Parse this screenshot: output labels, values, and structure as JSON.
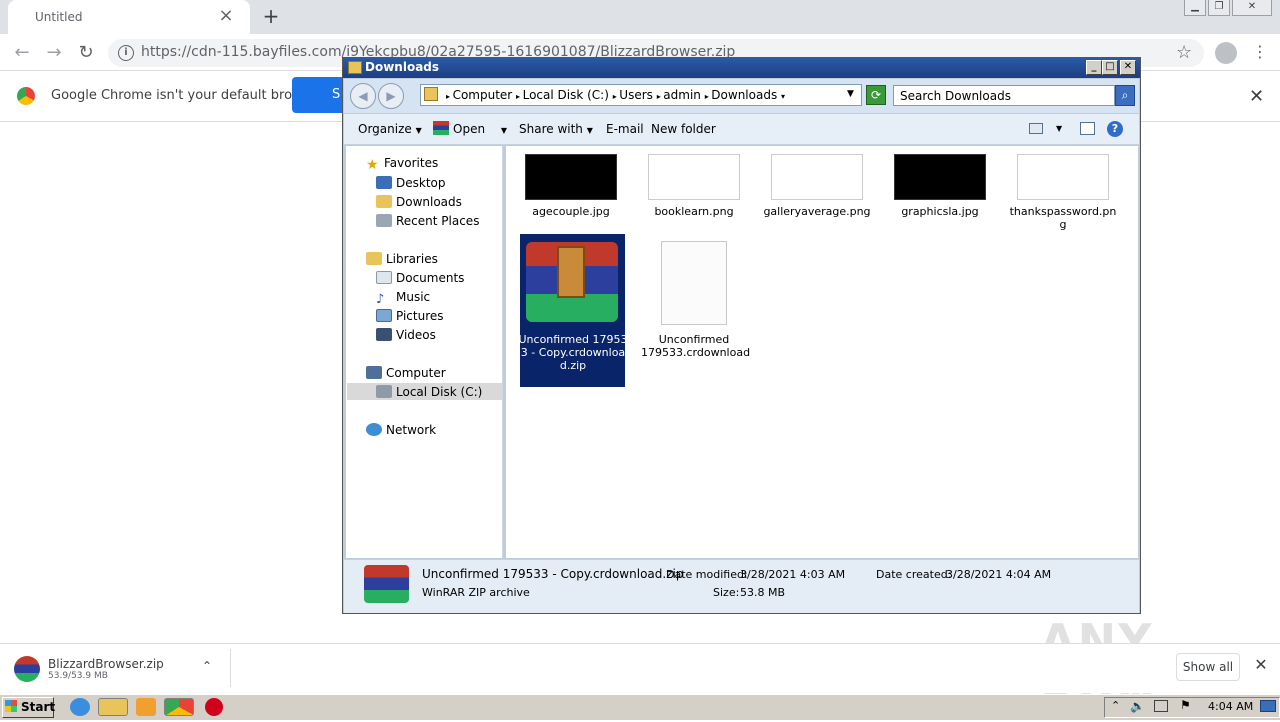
{
  "browser": {
    "tab_title": "Untitled",
    "url": "https://cdn-115.bayfiles.com/i9Yekcpbu8/02a27595-1616901087/BlizzardBrowser.zip",
    "infobar_text": "Google Chrome isn't your default browser",
    "infobar_button": "S"
  },
  "explorer": {
    "title": "Downloads",
    "breadcrumbs": [
      "Computer",
      "Local Disk (C:)",
      "Users",
      "admin",
      "Downloads"
    ],
    "search_placeholder": "Search Downloads",
    "commands": {
      "organize": "Organize",
      "open": "Open",
      "share_with": "Share with",
      "email": "E-mail",
      "new_folder": "New folder"
    },
    "nav": {
      "favorites": "Favorites",
      "desktop": "Desktop",
      "downloads": "Downloads",
      "recent_places": "Recent Places",
      "libraries": "Libraries",
      "documents": "Documents",
      "music": "Music",
      "pictures": "Pictures",
      "videos": "Videos",
      "computer": "Computer",
      "local_disk": "Local Disk (C:)",
      "network": "Network"
    },
    "files": [
      {
        "name": "agecouple.jpg"
      },
      {
        "name": "booklearn.png"
      },
      {
        "name": "galleryaverage.png"
      },
      {
        "name": "graphicsla.jpg"
      },
      {
        "name": "thankspassword.png"
      },
      {
        "name": "Unconfirmed 179533 - Copy.crdownload.zip"
      },
      {
        "name": "Unconfirmed 179533.crdownload"
      }
    ],
    "details": {
      "name": "Unconfirmed 179533 - Copy.crdownload.zip",
      "type": "WinRAR ZIP archive",
      "modified_label": "Date modified:",
      "modified": "3/28/2021 4:03 AM",
      "created_label": "Date created:",
      "created": "3/28/2021 4:04 AM",
      "size_label": "Size:",
      "size": "53.8 MB"
    }
  },
  "download_bar": {
    "filename": "BlizzardBrowser.zip",
    "progress": "53.9/53.9 MB",
    "show_all": "Show all"
  },
  "taskbar": {
    "start": "Start",
    "clock": "4:04 AM"
  },
  "watermark": "ANY RUN"
}
